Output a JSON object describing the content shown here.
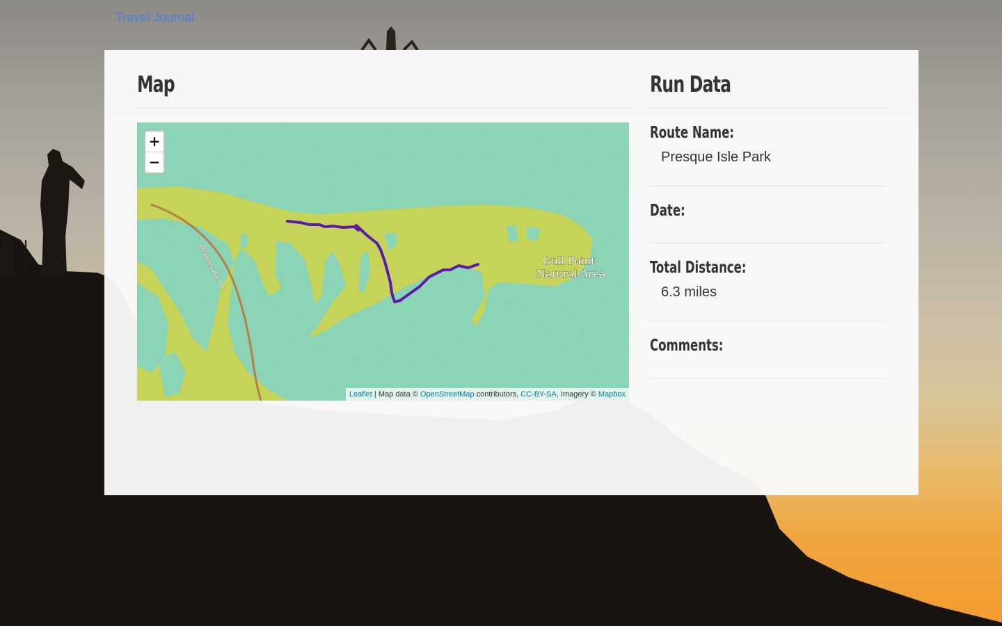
{
  "nav": {
    "brand": "Travel Journal"
  },
  "map_section": {
    "title": "Map",
    "zoom_in": "+",
    "zoom_out": "−",
    "labels": {
      "road": "Peninsula Dr",
      "area_line1": "Gull Point",
      "area_line2": "Natural Area"
    },
    "attribution": {
      "leaflet": "Leaflet",
      "sep": " | Map data © ",
      "osm": "OpenStreetMap",
      "contrib": " contributors, ",
      "license": "CC-BY-SA",
      "imagery": ", Imagery © ",
      "mapbox": "Mapbox"
    },
    "colors": {
      "water": "#86d6b4",
      "land": "#c7d64f",
      "route": "#5b1aa8",
      "road": "#b5793a"
    }
  },
  "run_data": {
    "title": "Run Data",
    "fields": [
      {
        "label": "Route Name:",
        "value": "Presque Isle Park"
      },
      {
        "label": "Date:",
        "value": ""
      },
      {
        "label": "Total Distance:",
        "value": "6.3 miles"
      },
      {
        "label": "Comments:",
        "value": ""
      }
    ]
  }
}
